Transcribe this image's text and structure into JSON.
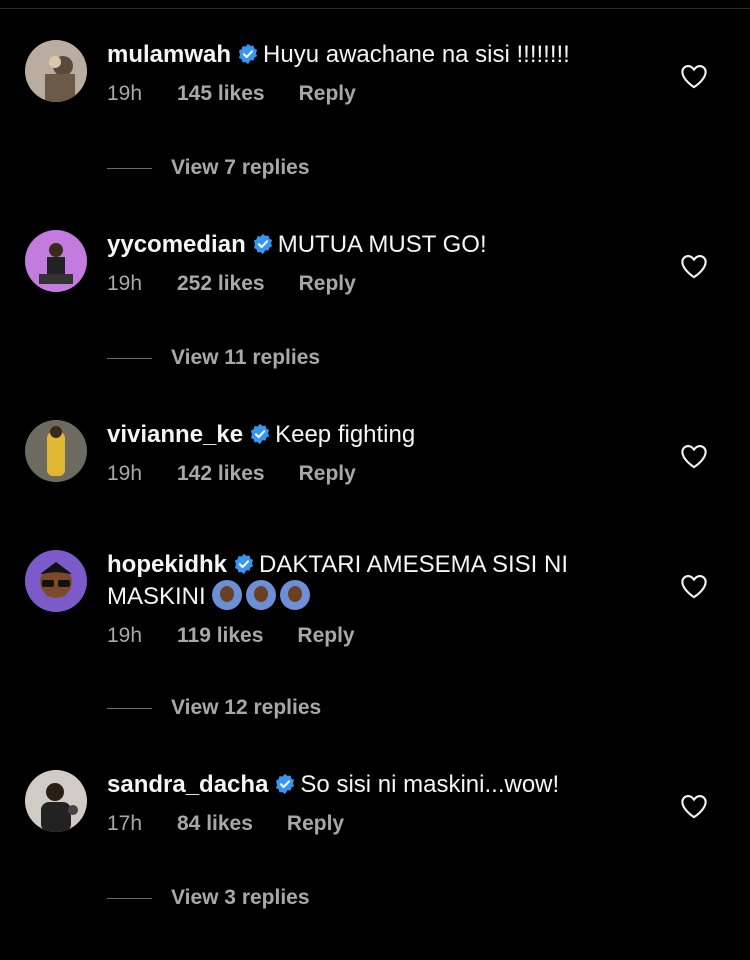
{
  "comments": [
    {
      "username": "mulamwah",
      "text": "Huyu awachane na sisi !!!!!!!!",
      "time": "19h",
      "likes": "145 likes",
      "reply": "Reply",
      "view_replies": "View 7 replies",
      "avatar_color": "#7a6a58"
    },
    {
      "username": "yycomedian",
      "text": "MUTUA MUST GO!",
      "time": "19h",
      "likes": "252 likes",
      "reply": "Reply",
      "view_replies": "View 11 replies",
      "avatar_color": "#b66fd1"
    },
    {
      "username": "vivianne_ke",
      "text": "Keep fighting",
      "time": "19h",
      "likes": "142 likes",
      "reply": "Reply",
      "avatar_color": "#caa12e"
    },
    {
      "username": "hopekidhk",
      "text": "DAKTARI AMESEMA SISI NI MASKINI",
      "time": "19h",
      "likes": "119 likes",
      "reply": "Reply",
      "view_replies": "View 12 replies",
      "avatar_color": "#7c5ac9"
    },
    {
      "username": "sandra_dacha",
      "text": "So sisi ni maskini...wow!",
      "time": "17h",
      "likes": "84 likes",
      "reply": "Reply",
      "view_replies": "View 3 replies",
      "avatar_color": "#555"
    }
  ],
  "colors": {
    "background": "#000000",
    "text": "#f5f5f5",
    "muted": "#a8a8a8",
    "verified": "#3797f0"
  },
  "icons": {
    "verified": "verified-badge-icon",
    "like": "heart-icon",
    "emoji": "person-gesturing-emoji"
  }
}
